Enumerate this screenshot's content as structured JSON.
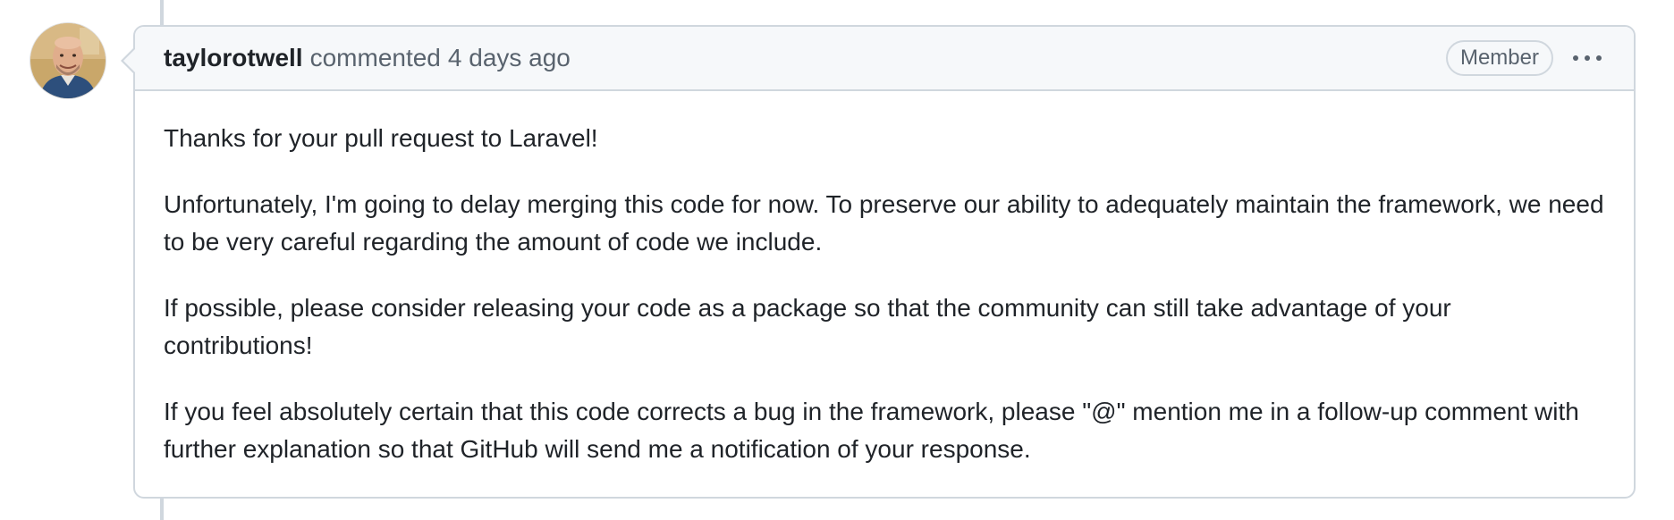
{
  "comment": {
    "author": "taylorotwell",
    "action_text": "commented",
    "timestamp": "4 days ago",
    "role_badge": "Member",
    "paragraphs": [
      "Thanks for your pull request to Laravel!",
      "Unfortunately, I'm going to delay merging this code for now. To preserve our ability to adequately maintain the framework, we need to be very careful regarding the amount of code we include.",
      "If possible, please consider releasing your code as a package so that the community can still take advantage of your contributions!",
      "If you feel absolutely certain that this code corrects a bug in the framework, please \"@\" mention me in a follow-up comment with further explanation so that GitHub will send me a notification of your response."
    ]
  },
  "icons": {
    "avatar": "user-avatar",
    "menu": "kebab-horizontal-icon"
  },
  "colors": {
    "border": "#d0d7de",
    "header_bg": "#f6f8fa",
    "text": "#1f2328",
    "muted": "#59636e"
  }
}
